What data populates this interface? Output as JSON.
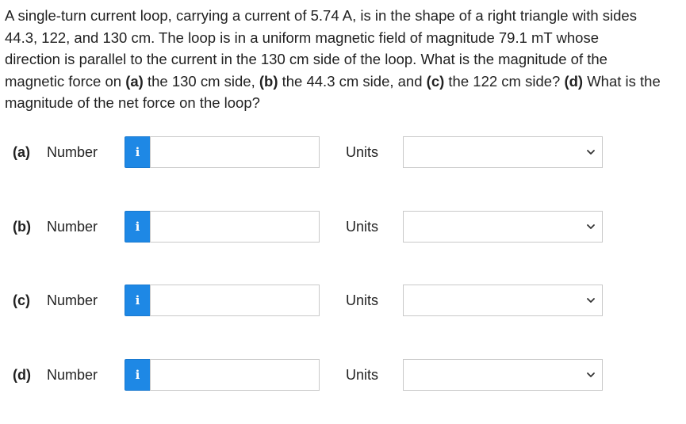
{
  "question": {
    "line1": "A single-turn current loop, carrying a current of 5.74 A, is in the shape of a right triangle with sides",
    "line2": "44.3, 122, and 130 cm. The loop is in a uniform magnetic field of magnitude 79.1 mT whose",
    "line3": "direction is parallel to the current in the 130 cm side of the loop. What is the magnitude of the",
    "line4_pre": "magnetic force on ",
    "line4_a": "(a)",
    "line4_mid1": " the 130 cm side, ",
    "line4_b": "(b)",
    "line4_mid2": " the 44.3 cm side, and ",
    "line4_c": "(c)",
    "line4_mid3": " the 122 cm side? ",
    "line4_d": "(d)",
    "line4_post": " What is the",
    "line5": "magnitude of the net force on the loop?"
  },
  "rows": [
    {
      "part": "(a)",
      "number_label": "Number",
      "info_icon": "i",
      "number_value": "",
      "units_label": "Units",
      "units_selected": ""
    },
    {
      "part": "(b)",
      "number_label": "Number",
      "info_icon": "i",
      "number_value": "",
      "units_label": "Units",
      "units_selected": ""
    },
    {
      "part": "(c)",
      "number_label": "Number",
      "info_icon": "i",
      "number_value": "",
      "units_label": "Units",
      "units_selected": ""
    },
    {
      "part": "(d)",
      "number_label": "Number",
      "info_icon": "i",
      "number_value": "",
      "units_label": "Units",
      "units_selected": ""
    }
  ],
  "colors": {
    "info_button": "#1e88e5",
    "text": "#222222",
    "input_border": "#c9c9c9"
  },
  "icons": {
    "info": "info-icon",
    "dropdown": "chevron-down-icon"
  }
}
